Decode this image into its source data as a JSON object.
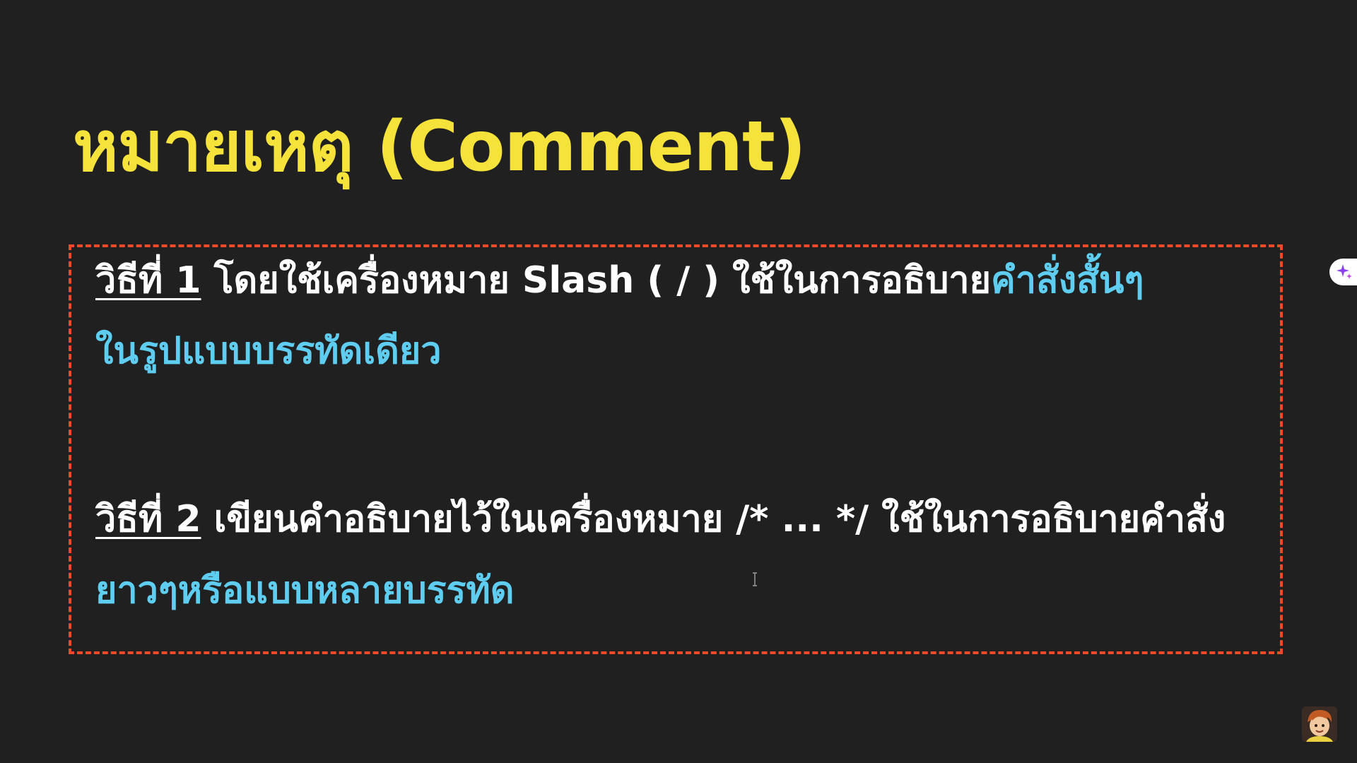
{
  "slide": {
    "title": "หมายเหตุ (Comment)",
    "method1": {
      "label": "วิธีที่ 1",
      "text": " โดยใช้เครื่องหมาย Slash ( / ) ใช้ในการอธิบาย",
      "highlight": "คำสั่งสั้นๆ",
      "line2": "ในรูปแบบบรรทัดเดียว"
    },
    "method2": {
      "label": "วิธีที่ 2",
      "text": " เขียนคำอธิบายไว้ในเครื่องหมาย /* ... */ ใช้ในการอธิบายคำสั่ง",
      "line2": "ยาวๆหรือแบบหลายบรรทัด"
    }
  },
  "icons": {
    "avatar": "avatar-icon",
    "side_tab": "sparkle-icon",
    "cursor": "text-cursor-icon"
  },
  "colors": {
    "background": "#202020",
    "title": "#f5e23a",
    "body_text": "#ffffff",
    "accent": "#5fcdf0",
    "box_border": "#ee4a2a"
  }
}
